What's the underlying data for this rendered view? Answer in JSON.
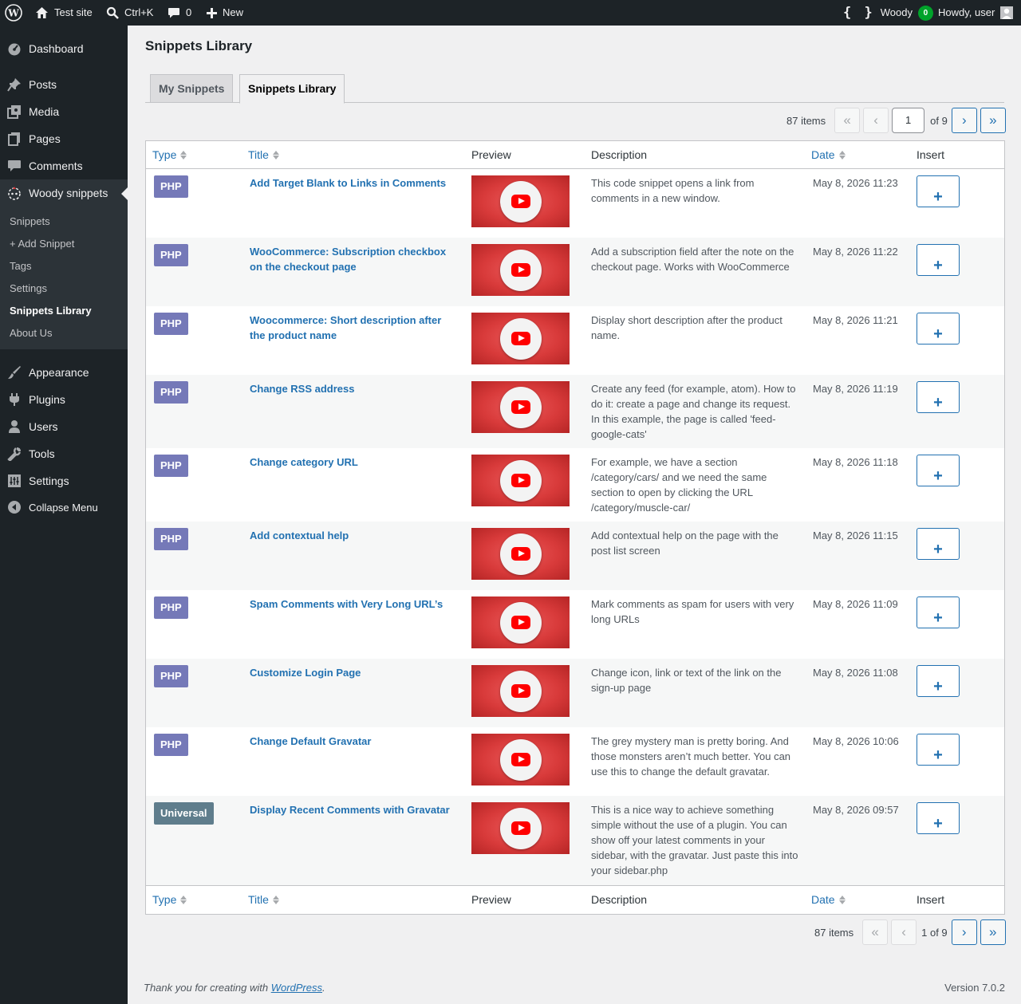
{
  "adminbar": {
    "site_name": "Test site",
    "search_shortcut": "Ctrl+K",
    "comments_count": "0",
    "new_label": "New",
    "woody_label": "Woody",
    "woody_count": "0",
    "howdy": "Howdy, user"
  },
  "sidebar": {
    "dashboard": "Dashboard",
    "posts": "Posts",
    "media": "Media",
    "pages": "Pages",
    "comments": "Comments",
    "woody": "Woody snippets",
    "submenu": [
      "Snippets",
      "+ Add Snippet",
      "Tags",
      "Settings",
      "Snippets Library",
      "About Us"
    ],
    "appearance": "Appearance",
    "plugins": "Plugins",
    "users": "Users",
    "tools": "Tools",
    "settings": "Settings",
    "collapse": "Collapse Menu"
  },
  "page": {
    "title": "Snippets Library",
    "tabs": [
      "My Snippets",
      "Snippets Library"
    ],
    "pager_top": {
      "items": "87 items",
      "current": "1",
      "of": "of 9"
    },
    "pager_bottom": {
      "items": "87 items",
      "text": "1 of 9"
    },
    "glyphs": {
      "first": "«",
      "prev": "‹",
      "next": "›",
      "last": "»",
      "insert": "+"
    }
  },
  "columns": {
    "type": "Type",
    "title": "Title",
    "preview": "Preview",
    "description": "Description",
    "date": "Date",
    "insert": "Insert"
  },
  "rows": [
    {
      "type": "PHP",
      "title": "Add Target Blank to Links in Comments",
      "description": "This code snippet opens a link from comments in a new window.",
      "date": "May 8, 2026 11:23"
    },
    {
      "type": "PHP",
      "title": "WooCommerce: Subscription checkbox on the checkout page",
      "description": "Add a subscription field after the note on the checkout page. Works with WooCommerce",
      "date": "May 8, 2026 11:22"
    },
    {
      "type": "PHP",
      "title": "Woocommerce: Short description after the product name",
      "description": "Display short description after the product name.",
      "date": "May 8, 2026 11:21"
    },
    {
      "type": "PHP",
      "title": "Change RSS address",
      "description": "Create any feed (for example, atom). How to do it: create a page and change its request. In this example, the page is called 'feed-google-cats'",
      "date": "May 8, 2026 11:19"
    },
    {
      "type": "PHP",
      "title": "Change category URL",
      "description": "For example, we have a section /category/cars/ and we need the same section to open by clicking the URL /category/muscle-car/",
      "date": "May 8, 2026 11:18"
    },
    {
      "type": "PHP",
      "title": "Add contextual help",
      "description": "Add contextual help on the page with the post list screen",
      "date": "May 8, 2026 11:15"
    },
    {
      "type": "PHP",
      "title": "Spam Comments with Very Long URL’s",
      "description": "Mark comments as spam for users with very long URLs",
      "date": "May 8, 2026 11:09"
    },
    {
      "type": "PHP",
      "title": "Customize Login Page",
      "description": "Change icon, link or text of the link on the sign-up page",
      "date": "May 8, 2026 11:08"
    },
    {
      "type": "PHP",
      "title": "Change Default Gravatar",
      "description": "The grey mystery man is pretty boring. And those monsters aren’t much better. You can use this to change the default gravatar.",
      "date": "May 8, 2026 10:06"
    },
    {
      "type": "Universal",
      "title": "Display Recent Comments with Gravatar",
      "description": "This is a nice way to achieve something simple without the use of a plugin. You can show off your latest comments in your sidebar, with the gravatar. Just paste this into your sidebar.php",
      "date": "May 8, 2026 09:57"
    }
  ],
  "footer": {
    "thanks_prefix": "Thank you for creating with ",
    "wp_link": "WordPress",
    "thanks_suffix": ".",
    "version": "Version 7.0.2"
  }
}
